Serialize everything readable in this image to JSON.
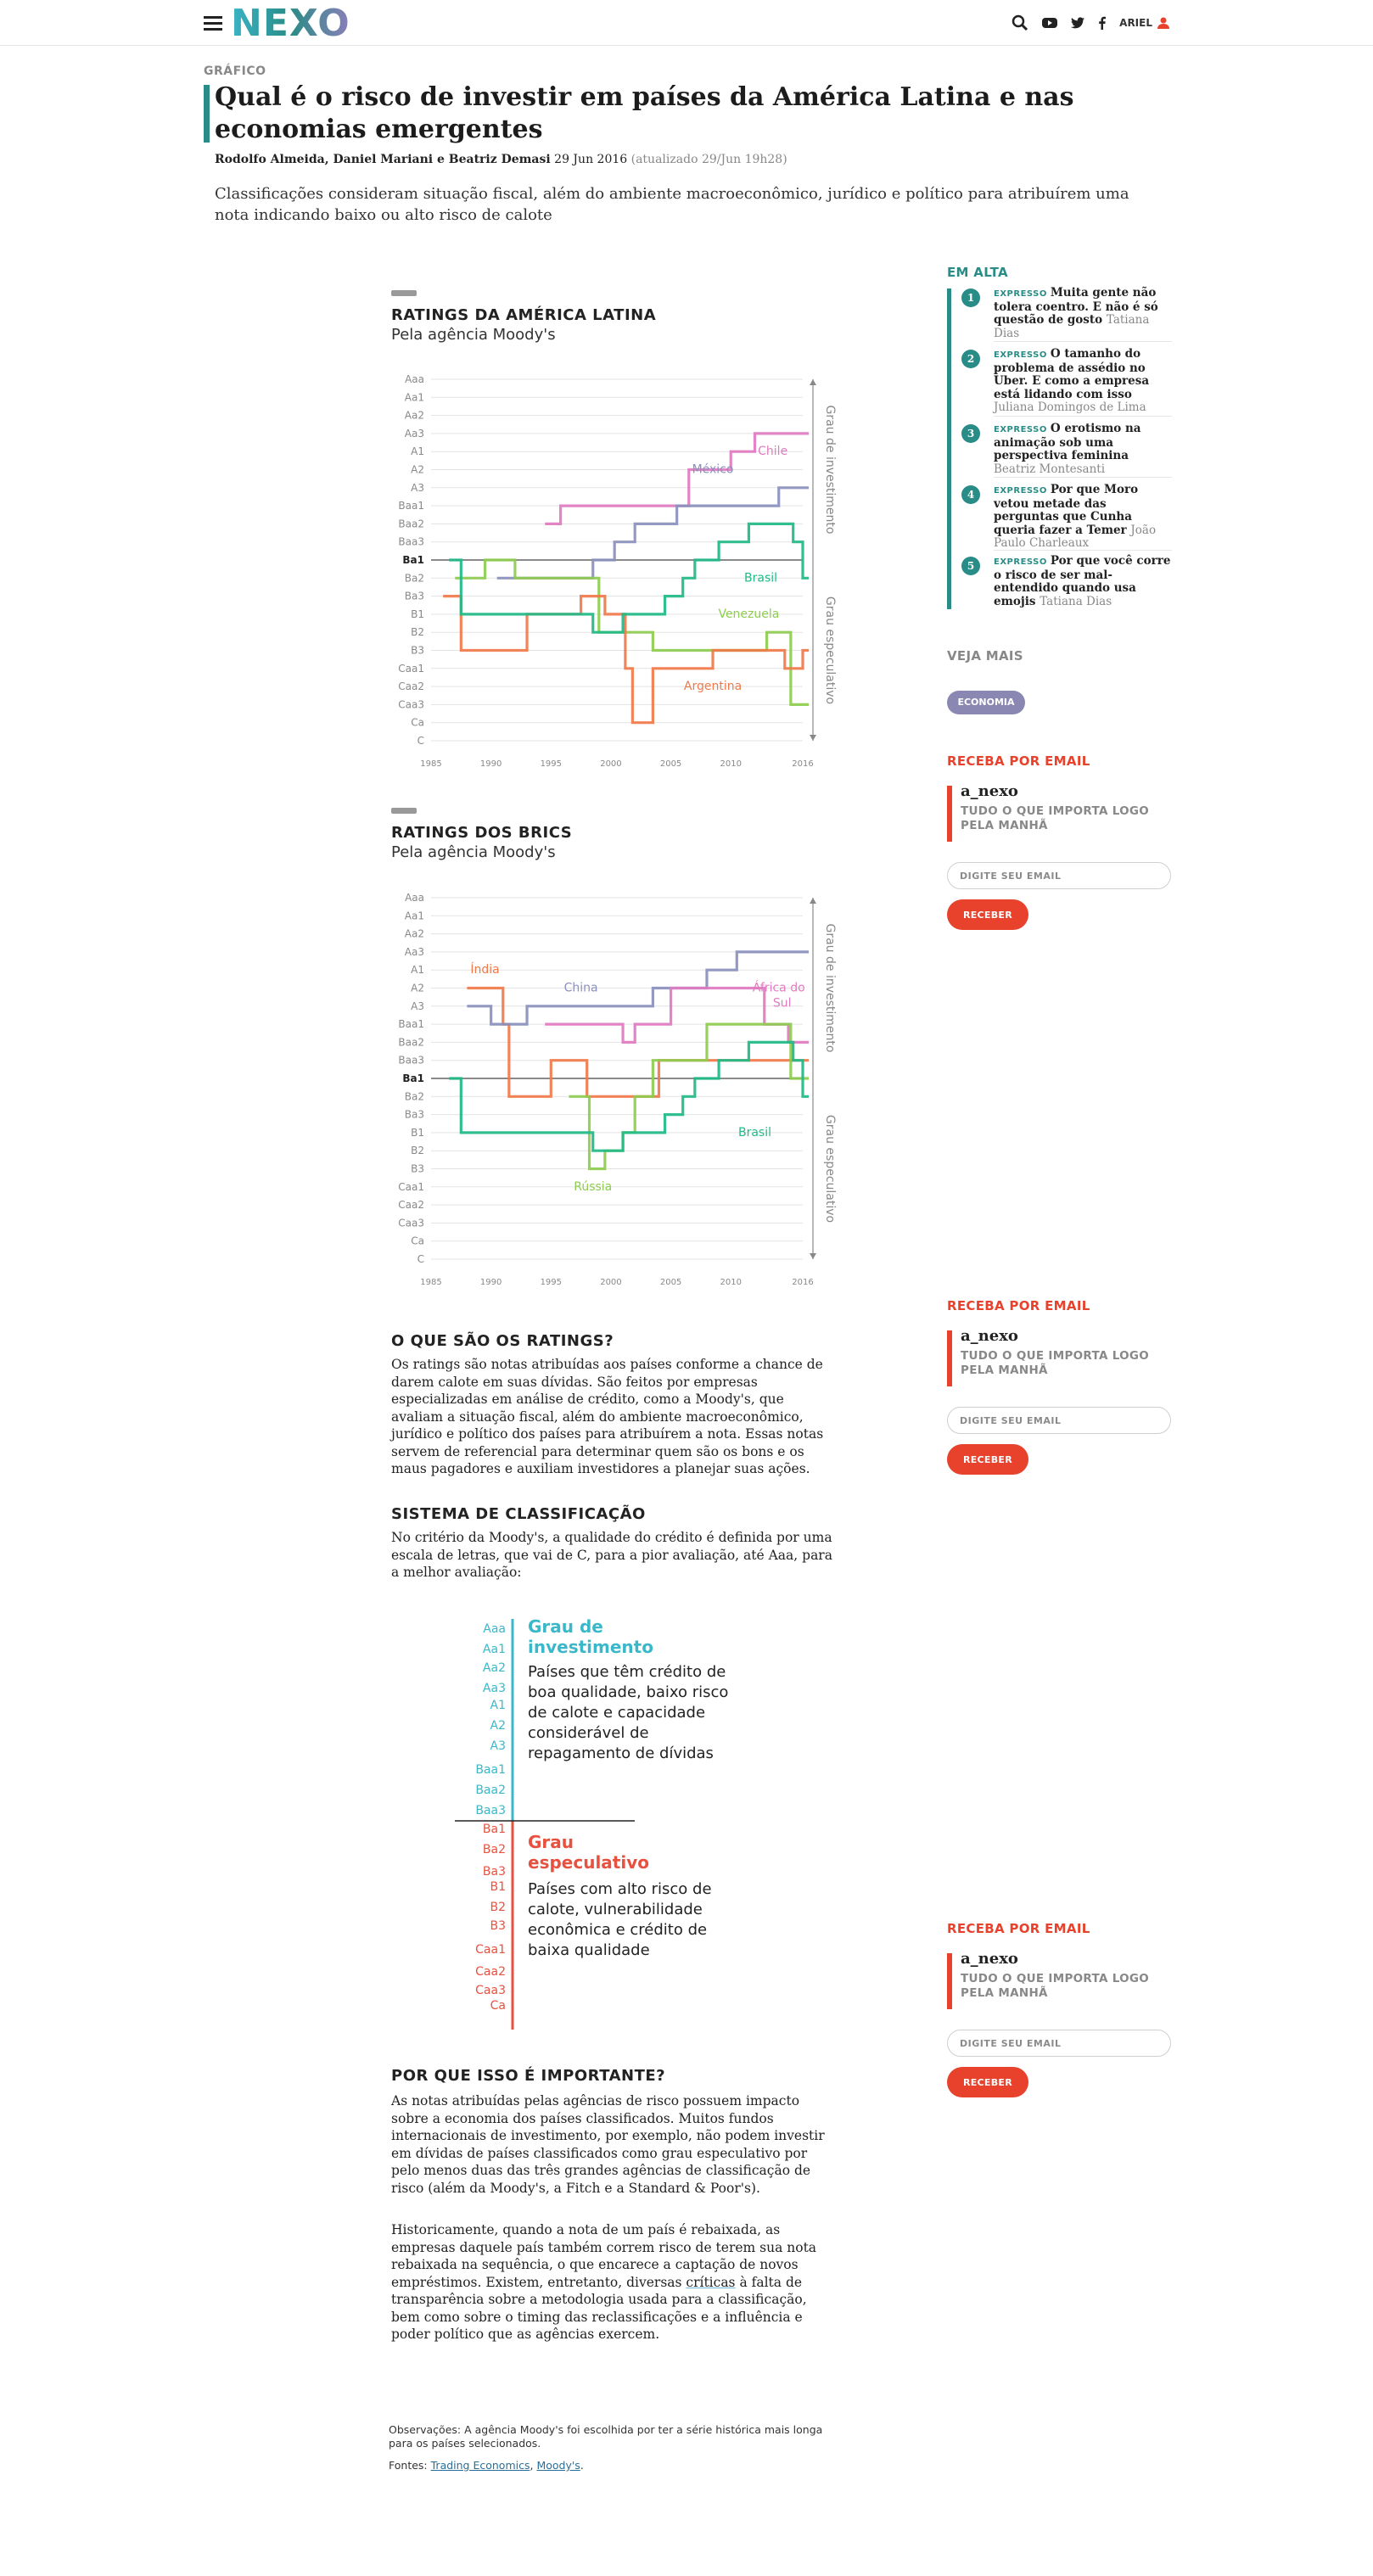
{
  "header": {
    "logo": "NEXO",
    "user_label": "ARIEL"
  },
  "article": {
    "kicker": "GRÁFICO",
    "title": "Qual é o risco de investir em países da América Latina e nas economias emergentes",
    "authors": "Rodolfo Almeida, Daniel Mariani e Beatriz Demasi",
    "date": "29 Jun 2016",
    "updated": "(atualizado 29/Jun 19h28)",
    "dek": "Classificações consideram situação fiscal, além do ambiente macroeconômico, jurídico e político para atribuírem uma nota indicando baixo ou alto risco de calote"
  },
  "charts": {
    "latam": {
      "title": "RATINGS DA AMÉRICA LATINA",
      "subtitle": "Pela agência Moody's"
    },
    "brics": {
      "title": "RATINGS DOS BRICS",
      "subtitle": "Pela agência Moody's"
    }
  },
  "chart_data": [
    {
      "type": "line",
      "title": "RATINGS DA AMÉRICA LATINA",
      "subtitle": "Pela agência Moody's",
      "y_categories": [
        "Aaa",
        "Aa1",
        "Aa2",
        "Aa3",
        "A1",
        "A2",
        "A3",
        "Baa1",
        "Baa2",
        "Baa3",
        "Ba1",
        "Ba2",
        "Ba3",
        "B1",
        "B2",
        "B3",
        "Caa1",
        "Caa2",
        "Caa3",
        "Ca",
        "C"
      ],
      "x_ticks": [
        1985,
        1990,
        1995,
        2000,
        2005,
        2010,
        2016
      ],
      "xlim": [
        1985,
        2016
      ],
      "divider_rating": "Ba1",
      "bands": [
        {
          "label": "Grau de investimento",
          "from": "Aaa",
          "to": "Ba1"
        },
        {
          "label": "Grau especulativo",
          "from": "Ba1",
          "to": "C"
        }
      ],
      "series": [
        {
          "name": "Chile",
          "color": "#e07ac0",
          "steps": [
            [
              1994.5,
              "Baa2"
            ],
            [
              1995.8,
              "Baa1"
            ],
            [
              2006.5,
              "A2"
            ],
            [
              2010,
              "A1"
            ],
            [
              2012,
              "Aa3"
            ],
            [
              2016.5,
              "Aa3"
            ]
          ]
        },
        {
          "name": "México",
          "color": "#8a90bd",
          "steps": [
            [
              1990.5,
              "Ba2"
            ],
            [
              1998.5,
              "Ba1"
            ],
            [
              2000.3,
              "Baa3"
            ],
            [
              2002,
              "Baa2"
            ],
            [
              2005.5,
              "Baa1"
            ],
            [
              2014,
              "A3"
            ],
            [
              2016.5,
              "A3"
            ]
          ]
        },
        {
          "name": "Brasil",
          "color": "#1fba88",
          "steps": [
            [
              1986.5,
              "Ba1"
            ],
            [
              1987.5,
              "B1"
            ],
            [
              1998.5,
              "B2"
            ],
            [
              2001,
              "B1"
            ],
            [
              2004.5,
              "Ba3"
            ],
            [
              2006,
              "Ba2"
            ],
            [
              2007,
              "Ba1"
            ],
            [
              2009,
              "Baa3"
            ],
            [
              2011.5,
              "Baa2"
            ],
            [
              2015.2,
              "Baa3"
            ],
            [
              2016,
              "Ba2"
            ],
            [
              2016.5,
              "Ba2"
            ]
          ]
        },
        {
          "name": "Venezuela",
          "color": "#8dcc4f",
          "steps": [
            [
              1987,
              "Ba2"
            ],
            [
              1989.5,
              "Ba1"
            ],
            [
              1992,
              "Ba2"
            ],
            [
              1999,
              "B2"
            ],
            [
              2003.5,
              "B3"
            ],
            [
              2013,
              "B2"
            ],
            [
              2015,
              "Caa3"
            ],
            [
              2016.5,
              "Caa3"
            ]
          ]
        },
        {
          "name": "Argentina",
          "color": "#f0794a",
          "steps": [
            [
              1986,
              "Ba3"
            ],
            [
              1987.5,
              "B3"
            ],
            [
              1993,
              "B1"
            ],
            [
              1997.5,
              "Ba3"
            ],
            [
              1999.5,
              "B1"
            ],
            [
              2001.2,
              "Caa1"
            ],
            [
              2001.8,
              "Ca"
            ],
            [
              2003.5,
              "Caa1"
            ],
            [
              2008.5,
              "B3"
            ],
            [
              2014.5,
              "Caa1"
            ],
            [
              2016,
              "B3"
            ],
            [
              2016.5,
              "B3"
            ]
          ]
        }
      ]
    },
    {
      "type": "line",
      "title": "RATINGS DOS BRICS",
      "subtitle": "Pela agência Moody's",
      "y_categories": [
        "Aaa",
        "Aa1",
        "Aa2",
        "Aa3",
        "A1",
        "A2",
        "A3",
        "Baa1",
        "Baa2",
        "Baa3",
        "Ba1",
        "Ba2",
        "Ba3",
        "B1",
        "B2",
        "B3",
        "Caa1",
        "Caa2",
        "Caa3",
        "Ca",
        "C"
      ],
      "x_ticks": [
        1985,
        1990,
        1995,
        2000,
        2005,
        2010,
        2016
      ],
      "xlim": [
        1985,
        2016
      ],
      "divider_rating": "Ba1",
      "bands": [
        {
          "label": "Grau de investimento",
          "from": "Aaa",
          "to": "Ba1"
        },
        {
          "label": "Grau especulativo",
          "from": "Ba1",
          "to": "C"
        }
      ],
      "series": [
        {
          "name": "Índia",
          "color": "#f0794a",
          "steps": [
            [
              1988,
              "A2"
            ],
            [
              1991,
              "Baa1"
            ],
            [
              1991.5,
              "Ba2"
            ],
            [
              1995,
              "Baa3"
            ],
            [
              1998,
              "Ba2"
            ],
            [
              2004,
              "Baa3"
            ],
            [
              2016.5,
              "Baa3"
            ]
          ]
        },
        {
          "name": "China",
          "color": "#8a90bd",
          "steps": [
            [
              1988,
              "A3"
            ],
            [
              1990,
              "Baa1"
            ],
            [
              1993,
              "A3"
            ],
            [
              1998,
              "A3"
            ],
            [
              2003.5,
              "A2"
            ],
            [
              2008,
              "A1"
            ],
            [
              2010.5,
              "Aa3"
            ],
            [
              2016.5,
              "Aa3"
            ]
          ]
        },
        {
          "name": "África do Sul",
          "color": "#e07ac0",
          "steps": [
            [
              1994.5,
              "Baa1"
            ],
            [
              2001,
              "Baa2"
            ],
            [
              2002,
              "Baa1"
            ],
            [
              2005,
              "A2"
            ],
            [
              2012.8,
              "Baa1"
            ],
            [
              2014.8,
              "Baa2"
            ],
            [
              2016.5,
              "Baa2"
            ]
          ]
        },
        {
          "name": "Rússia",
          "color": "#8dcc4f",
          "steps": [
            [
              1996.5,
              "Ba2"
            ],
            [
              1998.2,
              "B3"
            ],
            [
              1999.5,
              "B2"
            ],
            [
              2001,
              "B1"
            ],
            [
              2002,
              "Ba2"
            ],
            [
              2003.5,
              "Baa3"
            ],
            [
              2008,
              "Baa1"
            ],
            [
              2015,
              "Ba1"
            ],
            [
              2016.5,
              "Ba1"
            ]
          ]
        },
        {
          "name": "Brasil",
          "color": "#1fba88",
          "steps": [
            [
              1986.5,
              "Ba1"
            ],
            [
              1987.5,
              "B1"
            ],
            [
              1998.5,
              "B2"
            ],
            [
              2001,
              "B1"
            ],
            [
              2004.5,
              "Ba3"
            ],
            [
              2006,
              "Ba2"
            ],
            [
              2007,
              "Ba1"
            ],
            [
              2009,
              "Baa3"
            ],
            [
              2011.5,
              "Baa2"
            ],
            [
              2015.2,
              "Baa3"
            ],
            [
              2016,
              "Ba2"
            ],
            [
              2016.5,
              "Ba2"
            ]
          ]
        }
      ]
    }
  ],
  "sections": {
    "ratings_h": "O QUE SÃO OS RATINGS?",
    "ratings_p": "Os ratings são notas atribuídas aos países conforme a chance de darem calote em suas dívidas. São feitos por empresas especializadas em análise de crédito, como a Moody's, que avaliam a situação fiscal, além do ambiente macroeconômico, jurídico e político dos países para atribuírem a nota. Essas notas servem de referencial para determinar quem são os bons e os maus pagadores e auxiliam investidores a planejar suas ações.",
    "sistema_h": "SISTEMA DE CLASSIFICAÇÃO",
    "sistema_p": "No critério da Moody's, a qualidade do crédito é definida por uma escala de letras, que vai de C, para a pior avaliação, até Aaa, para a melhor avaliação:",
    "importante_h": "POR QUE ISSO É IMPORTANTE?",
    "importante_p1": "As notas atribuídas pelas agências de risco possuem impacto sobre a economia dos países classificados. Muitos fundos internacionais de investimento, por exemplo, não podem investir em dívidas de países classificados como grau especulativo por pelo menos duas das três grandes agências de classificação de risco (além da Moody's, a Fitch e a Standard & Poor's).",
    "importante_p2_a": "Historicamente, quando a nota de um país é rebaixada, as empresas daquele país também correm risco de terem sua nota rebaixada na sequência, o que encarece a captação de novos empréstimos. Existem, entretanto, diversas ",
    "importante_p2_link": "críticas",
    "importante_p2_b": " à falta de transparência sobre a metodologia usada para a classificação, bem como sobre o timing das reclassificações e a influência e poder político que as agências exercem."
  },
  "scale": {
    "invest_ratings": [
      "Aaa",
      "Aa1",
      "Aa2",
      "Aa3",
      "A1",
      "A2",
      "A3",
      "Baa1",
      "Baa2",
      "Baa3"
    ],
    "spec_ratings": [
      "Ba1",
      "Ba2",
      "Ba3",
      "B1",
      "B2",
      "B3",
      "Caa1",
      "Caa2",
      "Caa3",
      "Ca"
    ],
    "invest_title_1": "Grau de",
    "invest_title_2": "investimento",
    "invest_desc": [
      "Países que têm crédito de",
      "boa qualidade, baixo risco",
      "de calote e capacidade",
      "considerável de",
      "repagamento de dívidas"
    ],
    "spec_title_1": "Grau",
    "spec_title_2": "especulativo",
    "spec_desc": [
      "Países com alto risco de",
      "calote, vulnerabilidade",
      "econômica e crédito de",
      "baixa qualidade"
    ],
    "invest_color": "#3ab8c9",
    "spec_color": "#e8513f"
  },
  "notes": {
    "obs": "Observações: A agência Moody's foi escolhida por ter a série histórica mais longa para os países selecionados.",
    "fontes_label": "Fontes:",
    "fonte1": "Trading Economics",
    "fonte_sep": ", ",
    "fonte2": "Moody's",
    "fonte_end": "."
  },
  "sidebar": {
    "trending_title": "EM ALTA",
    "trending": [
      {
        "num": "1",
        "tag": "EXPRESSO",
        "text": "Muita gente não tolera coentro. E não é só questão de gosto",
        "author": "Tatiana Dias"
      },
      {
        "num": "2",
        "tag": "EXPRESSO",
        "text": "O tamanho do problema de assédio no Uber. E como a empresa está lidando com isso",
        "author": "Juliana Domingos de Lima"
      },
      {
        "num": "3",
        "tag": "EXPRESSO",
        "text": "O erotismo na animação sob uma perspectiva feminina",
        "author": "Beatriz Montesanti"
      },
      {
        "num": "4",
        "tag": "EXPRESSO",
        "text": "Por que Moro vetou metade das perguntas que Cunha queria fazer a Temer",
        "author": "João Paulo Charleaux"
      },
      {
        "num": "5",
        "tag": "EXPRESSO",
        "text": "Por que você corre o risco de ser mal-entendido quando usa emojis",
        "author": "Tatiana Dias"
      }
    ],
    "veja_title": "VEJA MAIS",
    "veja_pill": "ECONOMIA",
    "newsletter": {
      "title": "RECEBA POR EMAIL",
      "brand": "a_nexo",
      "desc": "TUDO O QUE IMPORTA LOGO PELA MANHÃ",
      "placeholder": "DIGITE SEU EMAIL",
      "button": "RECEBER"
    }
  }
}
